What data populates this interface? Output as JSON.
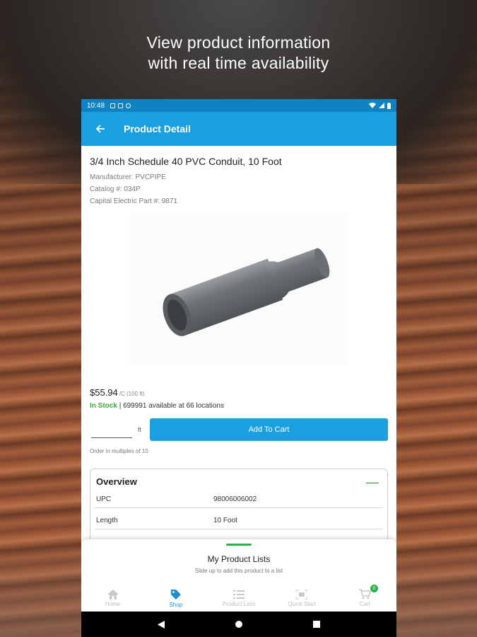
{
  "headline": {
    "line1": "View product information",
    "line2": "with real time availability"
  },
  "status_bar": {
    "time": "10:48"
  },
  "app_bar": {
    "title": "Product Detail"
  },
  "product": {
    "name": "3/4 Inch Schedule 40 PVC Conduit, 10 Foot",
    "manufacturer": "Manufacturer: PVCPIPE",
    "catalog": "Catalog #: 034P",
    "part": "Capital Electric Part #: 9871",
    "price": "$55.94",
    "price_unit": "/C (100 ft)",
    "stock_status": "In Stock",
    "availability": "| 699991 available at 66 locations",
    "qty_value": "",
    "qty_unit": "ft",
    "add_to_cart_label": "Add To Cart",
    "multiples_note": "Order in multiples of 10"
  },
  "overview": {
    "title": "Overview",
    "toggle": "—",
    "rows": [
      {
        "key": "UPC",
        "value": "98006006002"
      },
      {
        "key": "Length",
        "value": "10 Foot"
      }
    ]
  },
  "bottom_sheet": {
    "title": "My Product Lists",
    "subtitle": "Slide up to add this product to a list"
  },
  "tabs": [
    {
      "label": "Home",
      "icon": "home-icon"
    },
    {
      "label": "Shop",
      "icon": "tag-icon",
      "active": true
    },
    {
      "label": "Product Lists",
      "icon": "list-icon"
    },
    {
      "label": "Quick Start",
      "icon": "scan-icon"
    },
    {
      "label": "Cart",
      "icon": "cart-icon",
      "badge": "0"
    }
  ],
  "colors": {
    "primary": "#1aa0e0",
    "status_bar": "#0f82c2",
    "in_stock": "#3aa83a",
    "accent_green": "#2bb14a"
  }
}
